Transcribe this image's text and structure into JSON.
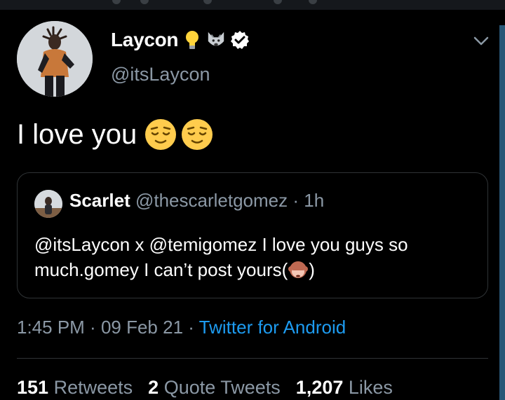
{
  "author": {
    "name": "Laycon",
    "handle": "@itsLaycon",
    "icons": [
      "lightbulb-icon",
      "wolf-icon",
      "verified-badge-icon"
    ]
  },
  "tweet": {
    "text": "I love you",
    "emojis": [
      "relieved-face-icon",
      "relieved-face-icon"
    ]
  },
  "quoted_tweet": {
    "name": "Scarlet",
    "handle": "@thescarletgomez",
    "separator": "·",
    "time": "1h",
    "text_before": "@itsLaycon x @temigomez I love you guys so much.gomey I can’t post yours(",
    "emoji": "see-no-evil-monkey-icon",
    "text_after": ")"
  },
  "timestamp": {
    "time": "1:45 PM",
    "sep1": " · ",
    "date": "09 Feb 21",
    "sep2": " · ",
    "source": "Twitter for Android"
  },
  "stats": {
    "retweets_count": "151",
    "retweets_label": "Retweets",
    "quotes_count": "2",
    "quotes_label": "Quote Tweets",
    "likes_count": "1,207",
    "likes_label": "Likes"
  },
  "colors": {
    "background": "#000000",
    "secondary_text": "#8b98a5",
    "link": "#1d9bf0",
    "border": "#2f3336"
  }
}
